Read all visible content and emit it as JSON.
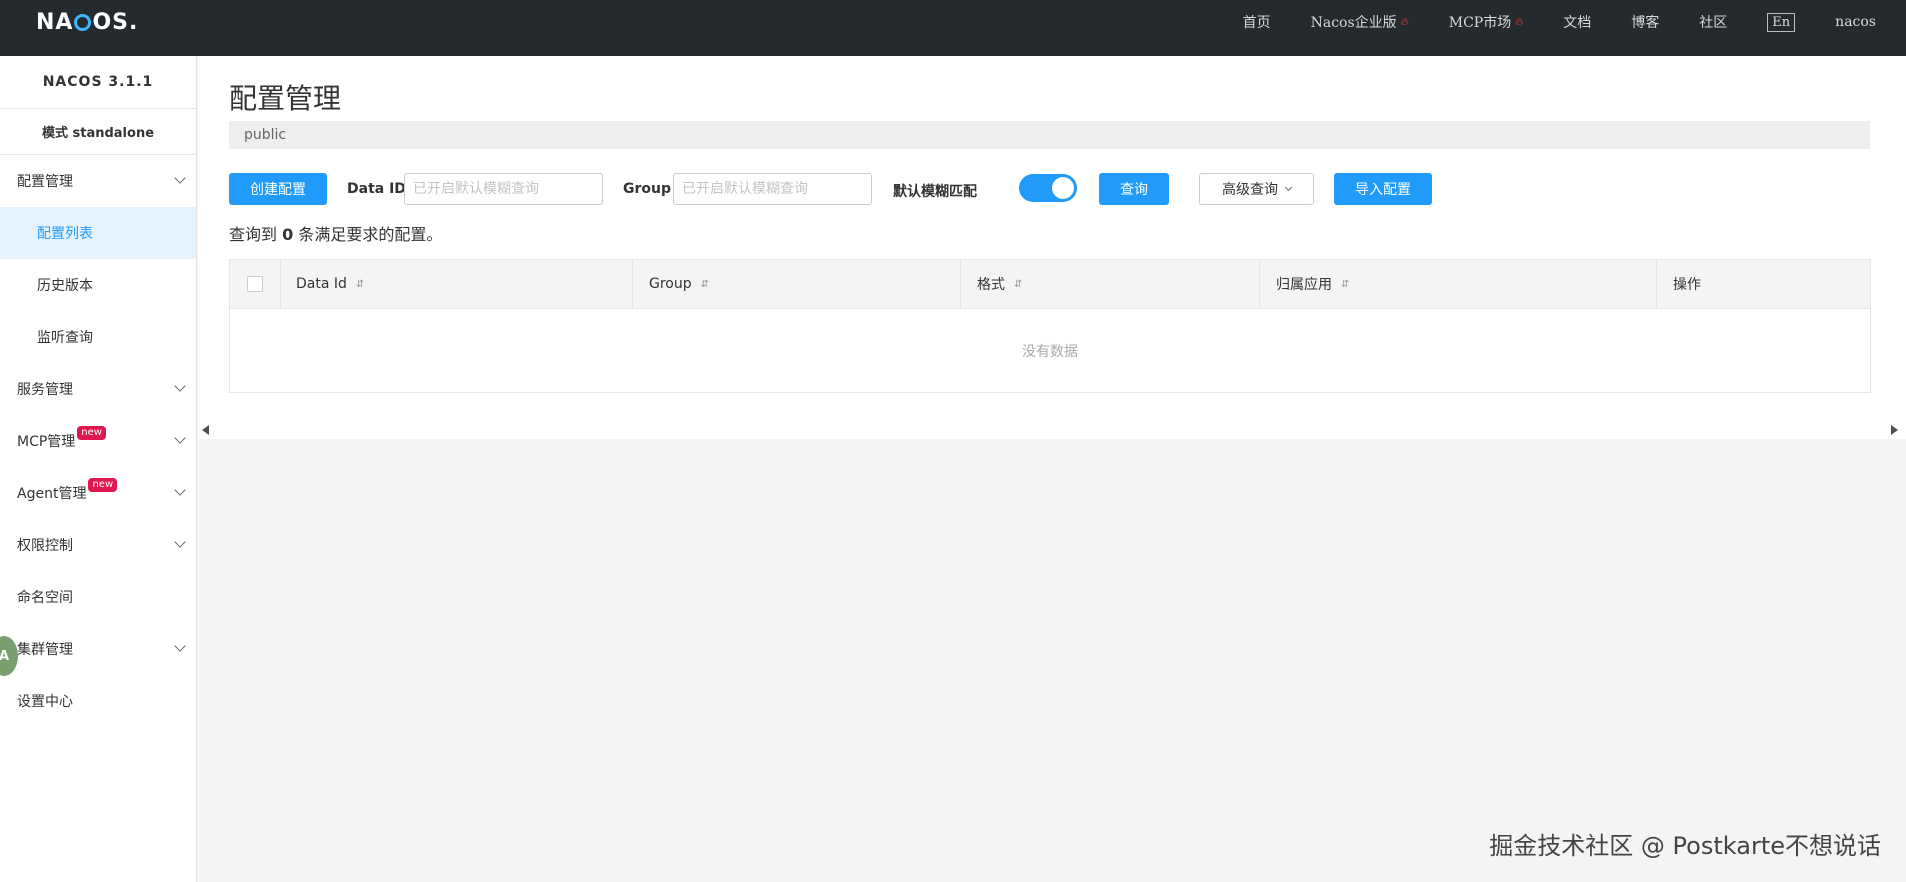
{
  "header": {
    "logo_text": "NACOS.",
    "nav": [
      {
        "label": "首页",
        "hot": false
      },
      {
        "label": "Nacos企业版",
        "hot": true
      },
      {
        "label": "MCP市场",
        "hot": true
      },
      {
        "label": "文档",
        "hot": false
      },
      {
        "label": "博客",
        "hot": false
      },
      {
        "label": "社区",
        "hot": false
      }
    ],
    "lang": "En",
    "user": "nacos"
  },
  "sidebar": {
    "version": "NACOS 3.1.1",
    "mode": "模式 standalone",
    "items": [
      {
        "label": "配置管理",
        "chevron": true
      },
      {
        "label": "配置列表",
        "active": true
      },
      {
        "label": "历史版本"
      },
      {
        "label": "监听查询"
      },
      {
        "label": "服务管理",
        "chevron": true
      },
      {
        "label": "MCP管理",
        "chevron": true,
        "badge": "new"
      },
      {
        "label": "Agent管理",
        "chevron": true,
        "badge": "new"
      },
      {
        "label": "权限控制",
        "chevron": true
      },
      {
        "label": "命名空间"
      },
      {
        "label": "集群管理",
        "chevron": true
      },
      {
        "label": "设置中心"
      }
    ],
    "avatar_letter": "A"
  },
  "main": {
    "title": "配置管理",
    "namespace": "public",
    "create_button": "创建配置",
    "data_id_label": "Data ID",
    "data_id_placeholder": "已开启默认模糊查询",
    "group_label": "Group",
    "group_placeholder": "已开启默认模糊查询",
    "fuzzy_label": "默认模糊匹配",
    "fuzzy_on": true,
    "query_button": "查询",
    "advanced_button": "高级查询",
    "import_button": "导入配置",
    "result_prefix": "查询到",
    "result_count": "0",
    "result_suffix": "条满足要求的配置。",
    "table": {
      "columns": [
        "Data Id",
        "Group",
        "格式",
        "归属应用",
        "操作"
      ],
      "empty_text": "没有数据"
    }
  },
  "watermark": "掘金技术社区 @ Postkarte不想说话",
  "colors": {
    "accent": "#209bfa",
    "header_bg": "#252a2f",
    "badge": "#e0164f"
  }
}
